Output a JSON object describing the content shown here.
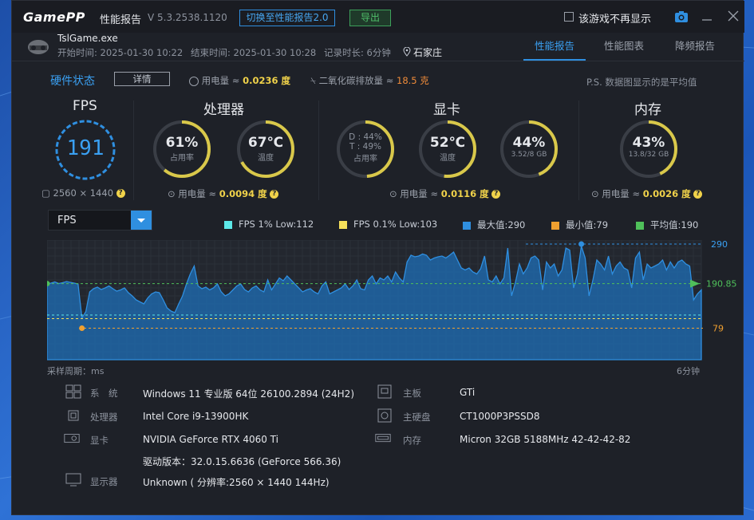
{
  "app": {
    "logo": "GamePP",
    "title": "性能报告",
    "version": "V 5.3.2538.1120"
  },
  "toolbar": {
    "switch_label": "切换至性能报告2.0",
    "export_label": "导出",
    "hide_label": "该游戏不再显示"
  },
  "session": {
    "game": "TslGame.exe",
    "start": "开始时间: 2025-01-30 10:22",
    "end": "结束时间: 2025-01-30 10:28",
    "duration": "记录时长: 6分钟",
    "city": "石家庄"
  },
  "tabs": [
    {
      "label": "性能报告",
      "active": true
    },
    {
      "label": "性能图表",
      "active": false
    },
    {
      "label": "降频报告",
      "active": false
    }
  ],
  "hardware": {
    "title": "硬件状态",
    "detail_label": "详情",
    "power_prefix": "用电量 ≈",
    "power_total": "0.0236 度",
    "co2_prefix": "二氧化碳排放量 ≈",
    "co2_value": "18.5 克",
    "note": "P.S. 数据图显示的是平均值"
  },
  "panels": {
    "fps": {
      "title": "FPS",
      "value": "191",
      "resolution": "2560 × 1440"
    },
    "cpu": {
      "title": "处理器",
      "usage": "61%",
      "usage_label": "占用率",
      "usage_frac": 0.61,
      "temp": "67℃",
      "temp_label": "温度",
      "temp_frac": 0.67,
      "power": "0.0094 度"
    },
    "gpu": {
      "title": "显卡",
      "d_line": "D : 44%",
      "t_line": "T : 49%",
      "usage_label": "占用率",
      "usage_frac": 0.49,
      "temp": "52℃",
      "temp_label": "温度",
      "temp_frac": 0.52,
      "vram": "44%",
      "vram_sub": "3.52/8 GB",
      "vram_frac": 0.44,
      "power": "0.0116 度"
    },
    "mem": {
      "title": "内存",
      "usage": "43%",
      "usage_sub": "13.8/32 GB",
      "usage_frac": 0.43,
      "power": "0.0026 度"
    }
  },
  "chart_select": {
    "value": "FPS"
  },
  "legend": [
    {
      "label": "FPS 1% Low:112",
      "color": "#5ce8e8"
    },
    {
      "label": "FPS 0.1% Low:103",
      "color": "#f5e05a"
    },
    {
      "label": "最大值:290",
      "color": "#2f8fe0"
    },
    {
      "label": "最小值:79",
      "color": "#f0a030"
    },
    {
      "label": "平均值:190",
      "color": "#4fc05a"
    }
  ],
  "chart_data": {
    "type": "area",
    "y_max_label": "290",
    "y_avg_label": "190.85",
    "y_min_label": "79",
    "ylim": [
      0,
      300
    ],
    "max": 290,
    "min": 79,
    "avg": 190.85,
    "low1": 112,
    "low01": 103,
    "x_start_label": "采样周期：ms",
    "x_end_label": "6分钟",
    "values": [
      190,
      192,
      195,
      191,
      193,
      196,
      194,
      192,
      190,
      105,
      120,
      170,
      178,
      182,
      176,
      180,
      185,
      178,
      172,
      175,
      180,
      168,
      160,
      150,
      145,
      140,
      155,
      165,
      170,
      168,
      150,
      130,
      122,
      118,
      140,
      160,
      190,
      215,
      235,
      185,
      178,
      182,
      175,
      180,
      190,
      170,
      160,
      165,
      175,
      185,
      190,
      176,
      170,
      180,
      185,
      175,
      170,
      200,
      175,
      190,
      205,
      198,
      210,
      200,
      190,
      180,
      170,
      175,
      178,
      170,
      165,
      185,
      195,
      165,
      170,
      175,
      180,
      190,
      176,
      185,
      200,
      178,
      175,
      200,
      210,
      190,
      205,
      200,
      210,
      195,
      220,
      205,
      195,
      245,
      262,
      258,
      260,
      265,
      262,
      250,
      255,
      258,
      260,
      255,
      262,
      270,
      250,
      230,
      225,
      230,
      220,
      215,
      228,
      260,
      200,
      195,
      210,
      190,
      205,
      280,
      160,
      195,
      240,
      215,
      230,
      255,
      260,
      250,
      175,
      245,
      230,
      240,
      210,
      225,
      280,
      275,
      180,
      215,
      285,
      255,
      160,
      200,
      250,
      240,
      225,
      260,
      215,
      235,
      245,
      230,
      225,
      180,
      255,
      270,
      200,
      240,
      230,
      235,
      240,
      250,
      225,
      245,
      230,
      245,
      250,
      240,
      235,
      150,
      165,
      175
    ]
  },
  "specs": {
    "os_label": "系　统",
    "os": "Windows 11 专业版 64位 26100.2894 (24H2)",
    "cpu_label": "处理器",
    "cpu": "Intel Core i9-13900HK",
    "gpu_label": "显卡",
    "gpu": "NVIDIA GeForce RTX 4060 Ti",
    "driver": "驱动版本：32.0.15.6636 (GeForce 566.36)",
    "display_label": "显示器",
    "display": "Unknown ( 分辨率:2560 × 1440 144Hz)",
    "board_label": "主板",
    "board": "GTi",
    "disk_label": "主硬盘",
    "disk": "CT1000P3PSSD8",
    "mem_label": "内存",
    "mem": "Micron 32GB 5188MHz 42-42-42-82"
  }
}
